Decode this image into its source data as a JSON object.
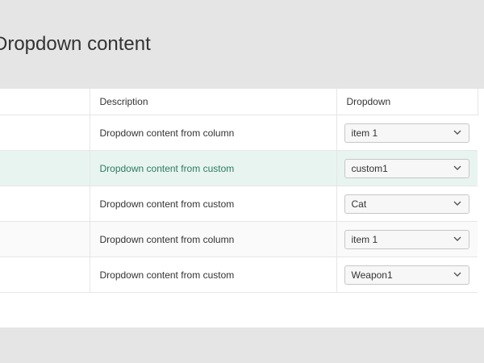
{
  "page": {
    "title": "Dropdown content"
  },
  "grid": {
    "columns": {
      "first": "",
      "description": "Description",
      "dropdown": "Dropdown"
    },
    "rows": [
      {
        "description": "Dropdown content from column",
        "dropdown_value": "item 1",
        "state": "normal"
      },
      {
        "description": "Dropdown content from custom",
        "dropdown_value": "custom1",
        "state": "selected"
      },
      {
        "description": "Dropdown content from custom",
        "dropdown_value": "Cat",
        "state": "normal"
      },
      {
        "description": "Dropdown content from column",
        "dropdown_value": "item 1",
        "state": "alt"
      },
      {
        "description": "Dropdown content from custom",
        "dropdown_value": "Weapon1",
        "state": "normal"
      }
    ]
  },
  "icons": {
    "dropdown_arrow": "chevron-down-icon"
  },
  "colors": {
    "background": "#e5e5e5",
    "panel": "#ffffff",
    "selected_row": "#e8f4f0",
    "selected_text": "#2f7a62",
    "border": "#e6e6e6"
  }
}
